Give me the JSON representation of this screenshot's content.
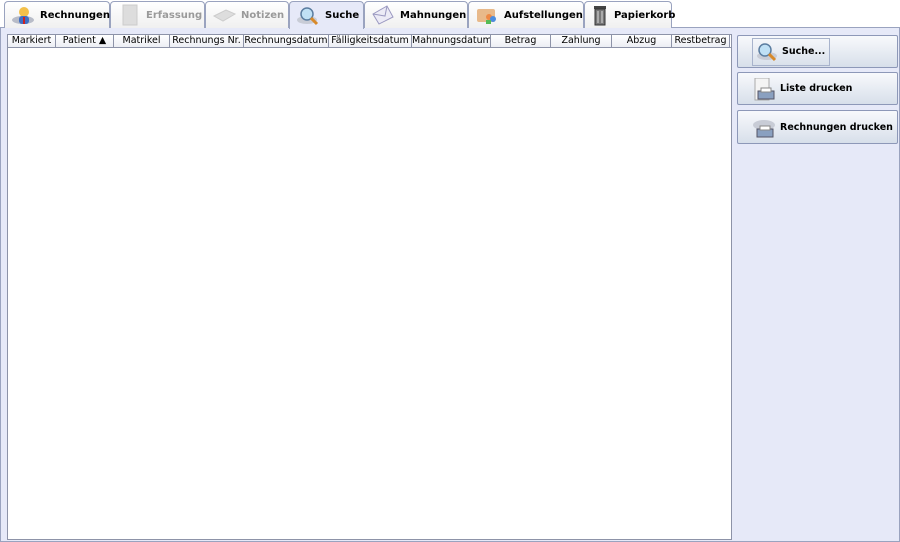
{
  "tabs": [
    {
      "label": "Rechnungen",
      "icon": "invoice-person-icon",
      "state": "normal"
    },
    {
      "label": "Erfassung",
      "icon": "entry-form-icon",
      "state": "disabled"
    },
    {
      "label": "Notizen",
      "icon": "notes-icon",
      "state": "disabled"
    },
    {
      "label": "Suche",
      "icon": "search-icon",
      "state": "selected"
    },
    {
      "label": "Mahnungen",
      "icon": "envelope-icon",
      "state": "normal"
    },
    {
      "label": "Aufstellungen",
      "icon": "folder-users-icon",
      "state": "normal"
    },
    {
      "label": "Papierkorb",
      "icon": "trash-icon",
      "state": "normal"
    }
  ],
  "table": {
    "columns": [
      "Markiert",
      "Patient ▲",
      "Matrikel",
      "Rechnungs Nr.",
      "Rechnungsdatum",
      "Fälligkeitsdatum",
      "Mahnungsdatum",
      "Betrag",
      "Zahlung",
      "Abzug",
      "Restbetrag"
    ],
    "rows": []
  },
  "actions": [
    {
      "label": "Suche...",
      "icon": "search-icon"
    },
    {
      "label": "Liste drucken",
      "icon": "print-list-icon"
    },
    {
      "label": "Rechnungen drucken",
      "icon": "print-invoices-icon"
    }
  ]
}
